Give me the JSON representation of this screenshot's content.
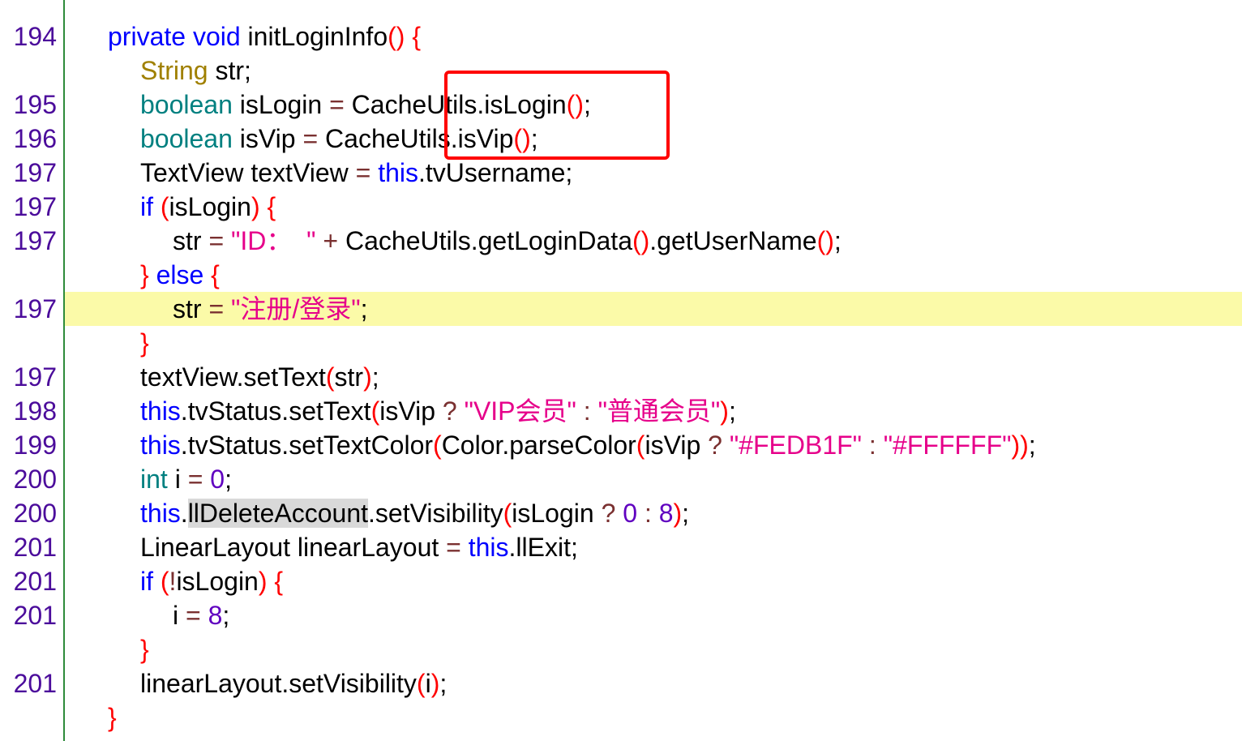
{
  "lines": [
    {
      "ln": "194",
      "indent": 1,
      "hl": false,
      "tokens": [
        {
          "t": "private void ",
          "c": "kw"
        },
        {
          "t": "initLoginInfo",
          "c": "pl"
        },
        {
          "t": "() {",
          "c": "br"
        }
      ]
    },
    {
      "ln": "",
      "indent": 2,
      "hl": false,
      "tokens": [
        {
          "t": "String",
          "c": "cls"
        },
        {
          "t": " str;",
          "c": "pl"
        }
      ]
    },
    {
      "ln": "195",
      "indent": 2,
      "hl": false,
      "tokens": [
        {
          "t": "boolean",
          "c": "ty"
        },
        {
          "t": " isLogin ",
          "c": "pl"
        },
        {
          "t": "=",
          "c": "op"
        },
        {
          "t": " CacheUtils.isLogin",
          "c": "pl"
        },
        {
          "t": "()",
          "c": "br"
        },
        {
          "t": ";",
          "c": "pl"
        }
      ]
    },
    {
      "ln": "196",
      "indent": 2,
      "hl": false,
      "tokens": [
        {
          "t": "boolean",
          "c": "ty"
        },
        {
          "t": " isVip ",
          "c": "pl"
        },
        {
          "t": "=",
          "c": "op"
        },
        {
          "t": " CacheUtils.isVip",
          "c": "pl"
        },
        {
          "t": "()",
          "c": "br"
        },
        {
          "t": ";",
          "c": "pl"
        }
      ]
    },
    {
      "ln": "197",
      "indent": 2,
      "hl": false,
      "tokens": [
        {
          "t": "TextView textView ",
          "c": "pl"
        },
        {
          "t": "=",
          "c": "op"
        },
        {
          "t": " ",
          "c": "pl"
        },
        {
          "t": "this",
          "c": "kw"
        },
        {
          "t": ".tvUsername;",
          "c": "pl"
        }
      ]
    },
    {
      "ln": "197",
      "indent": 2,
      "hl": false,
      "tokens": [
        {
          "t": "if",
          "c": "kw"
        },
        {
          "t": " ",
          "c": "pl"
        },
        {
          "t": "(",
          "c": "br"
        },
        {
          "t": "isLogin",
          "c": "pl"
        },
        {
          "t": ") {",
          "c": "br"
        }
      ]
    },
    {
      "ln": "197",
      "indent": 3,
      "hl": false,
      "tokens": [
        {
          "t": "str ",
          "c": "pl"
        },
        {
          "t": "=",
          "c": "op"
        },
        {
          "t": " ",
          "c": "pl"
        },
        {
          "t": "\"ID：  \"",
          "c": "str"
        },
        {
          "t": " + ",
          "c": "op"
        },
        {
          "t": "CacheUtils.getLoginData",
          "c": "pl"
        },
        {
          "t": "()",
          "c": "br"
        },
        {
          "t": ".getUserName",
          "c": "pl"
        },
        {
          "t": "()",
          "c": "br"
        },
        {
          "t": ";",
          "c": "pl"
        }
      ]
    },
    {
      "ln": "",
      "indent": 2,
      "hl": false,
      "tokens": [
        {
          "t": "}",
          "c": "br"
        },
        {
          "t": " else ",
          "c": "kw"
        },
        {
          "t": "{",
          "c": "br"
        }
      ]
    },
    {
      "ln": "197",
      "indent": 3,
      "hl": true,
      "tokens": [
        {
          "t": "str ",
          "c": "pl"
        },
        {
          "t": "=",
          "c": "op"
        },
        {
          "t": " ",
          "c": "pl"
        },
        {
          "t": "\"注册/登录\"",
          "c": "str"
        },
        {
          "t": ";",
          "c": "pl"
        }
      ]
    },
    {
      "ln": "",
      "indent": 2,
      "hl": false,
      "tokens": [
        {
          "t": "}",
          "c": "br"
        }
      ]
    },
    {
      "ln": "197",
      "indent": 2,
      "hl": false,
      "tokens": [
        {
          "t": "textView.setText",
          "c": "pl"
        },
        {
          "t": "(",
          "c": "br"
        },
        {
          "t": "str",
          "c": "pl"
        },
        {
          "t": ")",
          "c": "br"
        },
        {
          "t": ";",
          "c": "pl"
        }
      ]
    },
    {
      "ln": "198",
      "indent": 2,
      "hl": false,
      "tokens": [
        {
          "t": "this",
          "c": "kw"
        },
        {
          "t": ".tvStatus.setText",
          "c": "pl"
        },
        {
          "t": "(",
          "c": "br"
        },
        {
          "t": "isVip ",
          "c": "pl"
        },
        {
          "t": "?",
          "c": "op"
        },
        {
          "t": " ",
          "c": "pl"
        },
        {
          "t": "\"VIP会员\"",
          "c": "str"
        },
        {
          "t": " : ",
          "c": "op"
        },
        {
          "t": "\"普通会员\"",
          "c": "str"
        },
        {
          "t": ")",
          "c": "br"
        },
        {
          "t": ";",
          "c": "pl"
        }
      ]
    },
    {
      "ln": "199",
      "indent": 2,
      "hl": false,
      "tokens": [
        {
          "t": "this",
          "c": "kw"
        },
        {
          "t": ".tvStatus.setTextColor",
          "c": "pl"
        },
        {
          "t": "(",
          "c": "br"
        },
        {
          "t": "Color.parseColor",
          "c": "pl"
        },
        {
          "t": "(",
          "c": "br"
        },
        {
          "t": "isVip ",
          "c": "pl"
        },
        {
          "t": "?",
          "c": "op"
        },
        {
          "t": " ",
          "c": "pl"
        },
        {
          "t": "\"#FEDB1F\"",
          "c": "str"
        },
        {
          "t": " : ",
          "c": "op"
        },
        {
          "t": "\"#FFFFFF\"",
          "c": "str"
        },
        {
          "t": "))",
          "c": "br"
        },
        {
          "t": ";",
          "c": "pl"
        }
      ]
    },
    {
      "ln": "200",
      "indent": 2,
      "hl": false,
      "tokens": [
        {
          "t": "int",
          "c": "ty"
        },
        {
          "t": " i ",
          "c": "pl"
        },
        {
          "t": "=",
          "c": "op"
        },
        {
          "t": " ",
          "c": "pl"
        },
        {
          "t": "0",
          "c": "num"
        },
        {
          "t": ";",
          "c": "pl"
        }
      ]
    },
    {
      "ln": "200",
      "indent": 2,
      "hl": false,
      "tokens": [
        {
          "t": "this",
          "c": "kw"
        },
        {
          "t": ".",
          "c": "pl"
        },
        {
          "t": "llDeleteAccount",
          "c": "pl sel"
        },
        {
          "t": ".setVisibility",
          "c": "pl"
        },
        {
          "t": "(",
          "c": "br"
        },
        {
          "t": "isLogin ",
          "c": "pl"
        },
        {
          "t": "?",
          "c": "op"
        },
        {
          "t": " ",
          "c": "pl"
        },
        {
          "t": "0",
          "c": "num"
        },
        {
          "t": " : ",
          "c": "op"
        },
        {
          "t": "8",
          "c": "num"
        },
        {
          "t": ")",
          "c": "br"
        },
        {
          "t": ";",
          "c": "pl"
        }
      ]
    },
    {
      "ln": "201",
      "indent": 2,
      "hl": false,
      "tokens": [
        {
          "t": "LinearLayout linearLayout ",
          "c": "pl"
        },
        {
          "t": "=",
          "c": "op"
        },
        {
          "t": " ",
          "c": "pl"
        },
        {
          "t": "this",
          "c": "kw"
        },
        {
          "t": ".llExit;",
          "c": "pl"
        }
      ]
    },
    {
      "ln": "201",
      "indent": 2,
      "hl": false,
      "tokens": [
        {
          "t": "if",
          "c": "kw"
        },
        {
          "t": " ",
          "c": "pl"
        },
        {
          "t": "(",
          "c": "br"
        },
        {
          "t": "!",
          "c": "op"
        },
        {
          "t": "isLogin",
          "c": "pl"
        },
        {
          "t": ") {",
          "c": "br"
        }
      ]
    },
    {
      "ln": "201",
      "indent": 3,
      "hl": false,
      "tokens": [
        {
          "t": "i ",
          "c": "pl"
        },
        {
          "t": "=",
          "c": "op"
        },
        {
          "t": " ",
          "c": "pl"
        },
        {
          "t": "8",
          "c": "num"
        },
        {
          "t": ";",
          "c": "pl"
        }
      ]
    },
    {
      "ln": "",
      "indent": 2,
      "hl": false,
      "tokens": [
        {
          "t": "}",
          "c": "br"
        }
      ]
    },
    {
      "ln": "201",
      "indent": 2,
      "hl": false,
      "tokens": [
        {
          "t": "linearLayout.setVisibility",
          "c": "pl"
        },
        {
          "t": "(",
          "c": "br"
        },
        {
          "t": "i",
          "c": "pl"
        },
        {
          "t": ")",
          "c": "br"
        },
        {
          "t": ";",
          "c": "pl"
        }
      ]
    },
    {
      "ln": "",
      "indent": 1,
      "hl": false,
      "tokens": [
        {
          "t": "}",
          "c": "br"
        }
      ]
    }
  ],
  "colors": {
    "highlight_line": "#fbfaa8",
    "annotation_box": "#ff0000",
    "gutter_line": "#2e8b3a",
    "line_number": "#4b0c9b"
  }
}
